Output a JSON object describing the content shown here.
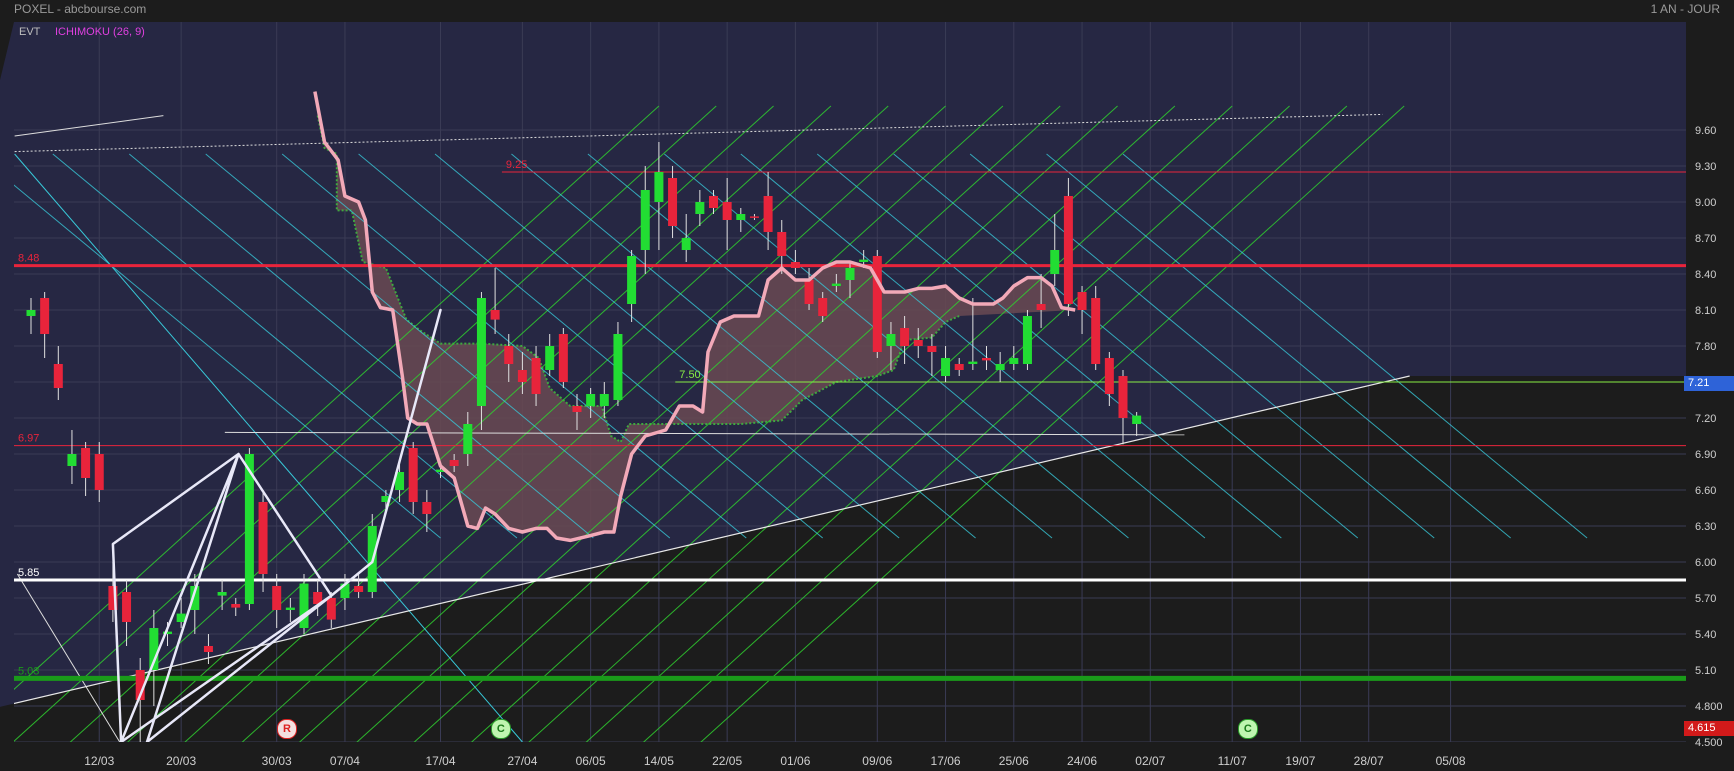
{
  "header": {
    "title": "POXEL - abcbourse.com",
    "period": "1 AN - JOUR"
  },
  "indicators": {
    "evt": "EVT",
    "ichimoku": "ICHIMOKU (26, 9)"
  },
  "colors": {
    "plot_bg": "#262743",
    "down_bg": "#1c1c1c",
    "up": "#22dd33",
    "down": "#e8243b",
    "cloud": "#6a4a52",
    "kijun": "#f2a9b8",
    "grid": "#3a3b55"
  },
  "current_price": "7.21",
  "last_low_price": "4.615",
  "badges": [
    {
      "label": "R",
      "kind": "r",
      "date_index": 2.5
    },
    {
      "label": "C",
      "kind": "c",
      "date_index": 5.35
    },
    {
      "label": "C",
      "kind": "c",
      "date_index": 15.3
    }
  ],
  "chart_data": {
    "type": "candlestick",
    "title": "POXEL - abcbourse.com",
    "x_ticks": [
      "12/03",
      "20/03",
      "30/03",
      "07/04",
      "17/04",
      "27/04",
      "06/05",
      "14/05",
      "22/05",
      "01/06",
      "09/06",
      "17/06",
      "25/06",
      "24/06",
      "02/07",
      "11/07",
      "19/07",
      "28/07",
      "05/08"
    ],
    "y_ticks": [
      "9.60",
      "9.30",
      "9.00",
      "8.70",
      "8.40",
      "8.10",
      "7.80",
      "7.50",
      "7.20",
      "6.90",
      "6.60",
      "6.30",
      "6.00",
      "5.70",
      "5.40",
      "5.10",
      "4.800",
      "4.500"
    ],
    "ylim": [
      4.5,
      9.72
    ],
    "levels": [
      {
        "label": "9.25",
        "value": 9.25,
        "color": "#e8243b",
        "width": 1
      },
      {
        "label": "8.48",
        "value": 8.47,
        "color": "#e8243b",
        "width": 3
      },
      {
        "label": "7.50",
        "value": 7.5,
        "color": "#88ee44",
        "width": 1
      },
      {
        "label": "6.97",
        "value": 6.97,
        "color": "#e8243b",
        "width": 1
      },
      {
        "label": "5.85",
        "value": 5.85,
        "color": "#ffffff",
        "width": 3
      },
      {
        "label": "5.03",
        "value": 5.03,
        "color": "#1a9a1a",
        "width": 5
      }
    ],
    "candles": [
      [
        8.05,
        8.1,
        8.2,
        7.9
      ],
      [
        8.2,
        7.9,
        8.25,
        7.7
      ],
      [
        7.65,
        7.45,
        7.8,
        7.35
      ],
      [
        6.8,
        6.9,
        7.1,
        6.65
      ],
      [
        6.95,
        6.7,
        7.0,
        6.55
      ],
      [
        6.9,
        6.6,
        7.0,
        6.5
      ],
      [
        5.8,
        5.6,
        6.0,
        5.5
      ],
      [
        5.75,
        5.5,
        5.85,
        5.3
      ],
      [
        5.1,
        4.85,
        5.2,
        4.5
      ],
      [
        5.1,
        5.45,
        5.6,
        4.8
      ],
      [
        5.4,
        5.42,
        5.5,
        5.3
      ],
      [
        5.5,
        5.57,
        5.7,
        5.45
      ],
      [
        5.6,
        5.8,
        5.9,
        5.4
      ],
      [
        5.3,
        5.25,
        5.4,
        5.15
      ],
      [
        5.72,
        5.75,
        5.85,
        5.6
      ],
      [
        5.65,
        5.62,
        5.7,
        5.55
      ],
      [
        5.65,
        6.9,
        6.95,
        5.6
      ],
      [
        6.5,
        5.9,
        6.6,
        5.75
      ],
      [
        5.8,
        5.6,
        5.9,
        5.45
      ],
      [
        5.6,
        5.62,
        5.7,
        5.5
      ],
      [
        5.45,
        5.82,
        5.9,
        5.4
      ],
      [
        5.75,
        5.65,
        5.85,
        5.55
      ],
      [
        5.7,
        5.52,
        5.75,
        5.45
      ],
      [
        5.7,
        5.82,
        5.9,
        5.6
      ],
      [
        5.8,
        5.75,
        5.9,
        5.7
      ],
      [
        5.75,
        6.3,
        6.4,
        5.7
      ],
      [
        6.5,
        6.55,
        6.6,
        6.45
      ],
      [
        6.6,
        6.75,
        6.85,
        6.5
      ],
      [
        6.95,
        6.5,
        7.0,
        6.4
      ],
      [
        6.5,
        6.4,
        6.6,
        6.25
      ],
      [
        6.75,
        6.77,
        6.8,
        6.7
      ],
      [
        6.85,
        6.8,
        6.9,
        6.75
      ],
      [
        6.9,
        7.15,
        7.25,
        6.8
      ],
      [
        7.3,
        8.2,
        8.25,
        7.1
      ],
      [
        8.1,
        8.02,
        8.45,
        7.9
      ],
      [
        7.8,
        7.65,
        7.9,
        7.5
      ],
      [
        7.6,
        7.5,
        7.75,
        7.4
      ],
      [
        7.7,
        7.4,
        7.8,
        7.3
      ],
      [
        7.6,
        7.8,
        7.9,
        7.55
      ],
      [
        7.9,
        7.5,
        7.95,
        7.45
      ],
      [
        7.3,
        7.25,
        7.4,
        7.1
      ],
      [
        7.3,
        7.4,
        7.45,
        7.2
      ],
      [
        7.3,
        7.4,
        7.5,
        7.2
      ],
      [
        7.35,
        7.9,
        8.0,
        7.3
      ],
      [
        8.15,
        8.55,
        8.6,
        8.0
      ],
      [
        8.6,
        9.1,
        9.3,
        8.4
      ],
      [
        9.0,
        9.25,
        9.5,
        8.6
      ],
      [
        9.2,
        8.8,
        9.3,
        8.7
      ],
      [
        8.6,
        8.7,
        8.9,
        8.5
      ],
      [
        8.9,
        9.0,
        9.1,
        8.8
      ],
      [
        9.05,
        8.95,
        9.1,
        8.9
      ],
      [
        9.0,
        8.85,
        9.2,
        8.6
      ],
      [
        8.85,
        8.9,
        8.95,
        8.75
      ],
      [
        8.88,
        8.87,
        8.9,
        8.85
      ],
      [
        9.05,
        8.75,
        9.25,
        8.6
      ],
      [
        8.75,
        8.55,
        8.85,
        8.4
      ],
      [
        8.5,
        8.45,
        8.6,
        8.4
      ],
      [
        8.35,
        8.15,
        8.45,
        8.1
      ],
      [
        8.2,
        8.05,
        8.25,
        8.0
      ],
      [
        8.3,
        8.32,
        8.4,
        8.25
      ],
      [
        8.35,
        8.45,
        8.5,
        8.2
      ],
      [
        8.5,
        8.52,
        8.6,
        8.45
      ],
      [
        8.55,
        7.75,
        8.6,
        7.7
      ],
      [
        7.8,
        7.9,
        8.0,
        7.6
      ],
      [
        7.95,
        7.8,
        8.05,
        7.65
      ],
      [
        7.85,
        7.8,
        7.95,
        7.7
      ],
      [
        7.8,
        7.75,
        7.9,
        7.55
      ],
      [
        7.55,
        7.7,
        7.8,
        7.5
      ],
      [
        7.65,
        7.6,
        7.7,
        7.55
      ],
      [
        7.65,
        7.67,
        8.2,
        7.6
      ],
      [
        7.7,
        7.68,
        7.8,
        7.6
      ],
      [
        7.6,
        7.65,
        7.75,
        7.5
      ],
      [
        7.65,
        7.7,
        7.8,
        7.6
      ],
      [
        7.65,
        8.05,
        8.1,
        7.6
      ],
      [
        8.15,
        8.1,
        8.4,
        7.95
      ],
      [
        8.4,
        8.6,
        8.9,
        8.3
      ],
      [
        9.05,
        8.15,
        9.2,
        8.05
      ],
      [
        8.25,
        8.1,
        8.3,
        7.9
      ],
      [
        8.2,
        7.65,
        8.3,
        7.6
      ],
      [
        7.7,
        7.4,
        7.75,
        7.3
      ],
      [
        7.55,
        7.2,
        7.6,
        6.98
      ],
      [
        7.15,
        7.22,
        7.25,
        7.05
      ]
    ],
    "cloud_top": [
      [
        21.0,
        9.72
      ],
      [
        21.5,
        9.45
      ],
      [
        22.4,
        9.4
      ],
      [
        22.4,
        8.93
      ],
      [
        23.5,
        8.93
      ],
      [
        24.3,
        8.5
      ],
      [
        26.0,
        8.45
      ],
      [
        27.5,
        8.02
      ],
      [
        28.5,
        7.93
      ],
      [
        30.0,
        7.82
      ],
      [
        33.0,
        7.82
      ],
      [
        36.0,
        7.8
      ],
      [
        37.2,
        7.7
      ],
      [
        38.0,
        7.45
      ],
      [
        39.5,
        7.3
      ],
      [
        41.8,
        7.3
      ],
      [
        42.5,
        7.05
      ],
      [
        43.2,
        7.0
      ],
      [
        43.8,
        7.15
      ],
      [
        46.0,
        7.15
      ],
      [
        52.0,
        7.15
      ],
      [
        55.0,
        7.18
      ],
      [
        56.5,
        7.35
      ],
      [
        59.0,
        7.5
      ],
      [
        62.0,
        7.55
      ],
      [
        63.2,
        7.6
      ],
      [
        64.0,
        7.85
      ],
      [
        66.0,
        7.87
      ],
      [
        67.0,
        8.0
      ],
      [
        68.0,
        8.05
      ]
    ],
    "kijun": [
      [
        20.8,
        9.92
      ],
      [
        21.5,
        9.5
      ],
      [
        22.5,
        9.35
      ],
      [
        23.0,
        9.05
      ],
      [
        24.0,
        9.0
      ],
      [
        24.5,
        8.85
      ],
      [
        25.0,
        8.25
      ],
      [
        25.6,
        8.12
      ],
      [
        26.5,
        8.1
      ],
      [
        27.2,
        7.55
      ],
      [
        27.6,
        7.2
      ],
      [
        28.3,
        7.15
      ],
      [
        29.0,
        7.15
      ],
      [
        30.0,
        6.8
      ],
      [
        31.0,
        6.7
      ],
      [
        32.0,
        6.3
      ],
      [
        32.7,
        6.28
      ],
      [
        33.3,
        6.45
      ],
      [
        34.0,
        6.4
      ],
      [
        35.0,
        6.28
      ],
      [
        36.0,
        6.25
      ],
      [
        37.0,
        6.28
      ],
      [
        37.8,
        6.28
      ],
      [
        38.5,
        6.2
      ],
      [
        39.5,
        6.18
      ],
      [
        41.0,
        6.22
      ],
      [
        42.0,
        6.25
      ],
      [
        42.7,
        6.25
      ],
      [
        43.2,
        6.55
      ],
      [
        44.0,
        6.9
      ],
      [
        45.0,
        7.05
      ],
      [
        46.5,
        7.1
      ],
      [
        47.5,
        7.3
      ],
      [
        48.5,
        7.3
      ],
      [
        49.2,
        7.25
      ],
      [
        49.6,
        7.75
      ],
      [
        50.5,
        8.0
      ],
      [
        51.5,
        8.05
      ],
      [
        53.3,
        8.05
      ],
      [
        54.0,
        8.35
      ],
      [
        55.0,
        8.45
      ],
      [
        56.0,
        8.35
      ],
      [
        57.0,
        8.35
      ],
      [
        58.0,
        8.45
      ],
      [
        59.0,
        8.5
      ],
      [
        60.0,
        8.5
      ],
      [
        61.5,
        8.45
      ],
      [
        62.5,
        8.25
      ],
      [
        64.0,
        8.25
      ],
      [
        65.0,
        8.28
      ],
      [
        66.0,
        8.28
      ],
      [
        67.0,
        8.3
      ],
      [
        68.0,
        8.2
      ],
      [
        69.0,
        8.15
      ],
      [
        70.5,
        8.15
      ],
      [
        71.2,
        8.2
      ],
      [
        72.0,
        8.3
      ],
      [
        73.0,
        8.37
      ],
      [
        74.0,
        8.37
      ],
      [
        74.8,
        8.3
      ],
      [
        75.5,
        8.12
      ],
      [
        76.5,
        8.1
      ]
    ]
  }
}
